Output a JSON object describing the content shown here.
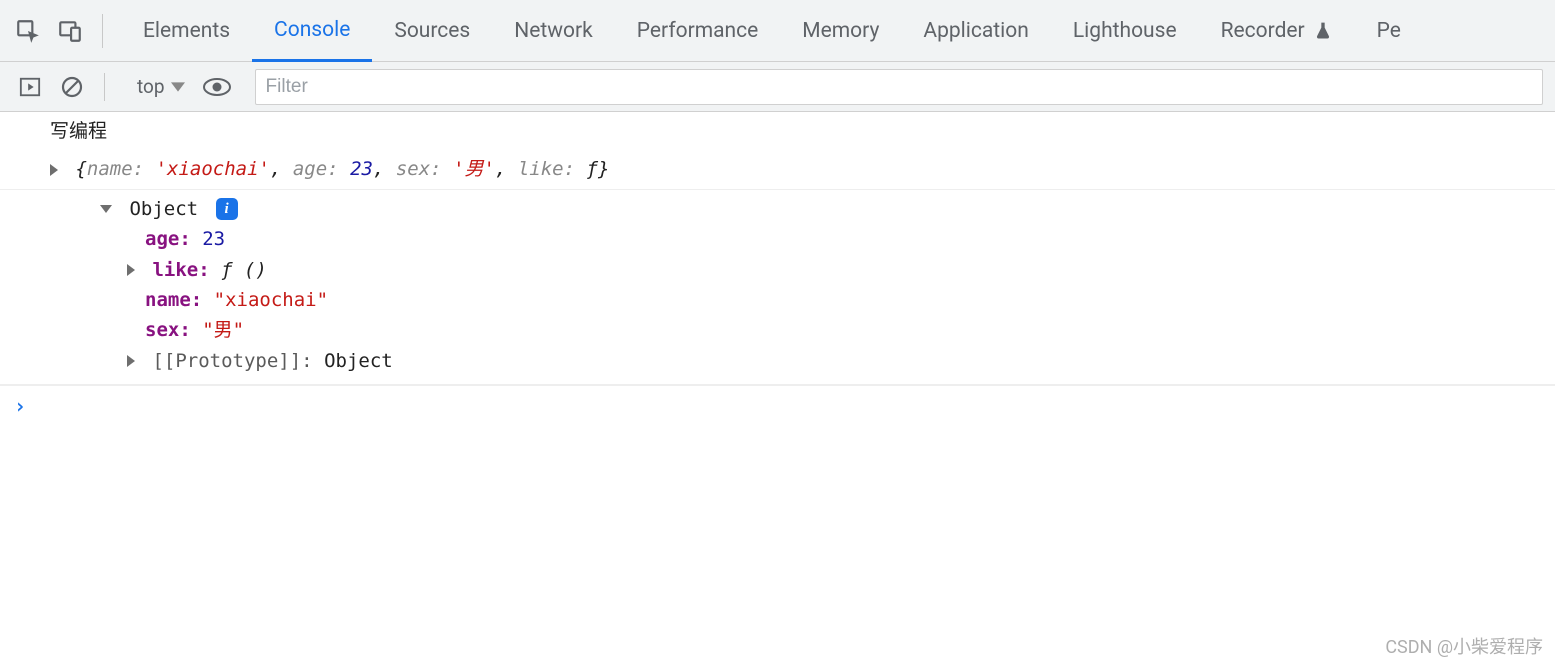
{
  "tabs": {
    "elements": "Elements",
    "console": "Console",
    "sources": "Sources",
    "network": "Network",
    "performance": "Performance",
    "memory": "Memory",
    "application": "Application",
    "lighthouse": "Lighthouse",
    "recorder": "Recorder",
    "last_partial": "Pe"
  },
  "toolbar": {
    "context": "top",
    "filter_placeholder": "Filter"
  },
  "console": {
    "line1_text": "写编程",
    "preview": {
      "open_brace": "{",
      "k_name": "name:",
      "v_name": "'xiaochai'",
      "sep": ", ",
      "k_age": "age:",
      "v_age": "23",
      "k_sex": "sex:",
      "v_sex": "'男'",
      "k_like": "like:",
      "v_like": "ƒ",
      "close_brace": "}"
    },
    "expanded": {
      "header": "Object",
      "info_glyph": "i",
      "age_key": "age:",
      "age_val": "23",
      "like_key": "like:",
      "like_val": "ƒ ()",
      "name_key": "name:",
      "name_val": "\"xiaochai\"",
      "sex_key": "sex:",
      "sex_val": "\"男\"",
      "proto_key": "[[Prototype]]:",
      "proto_val": "Object"
    },
    "prompt_symbol": "›"
  },
  "watermark": "CSDN @小柴爱程序"
}
